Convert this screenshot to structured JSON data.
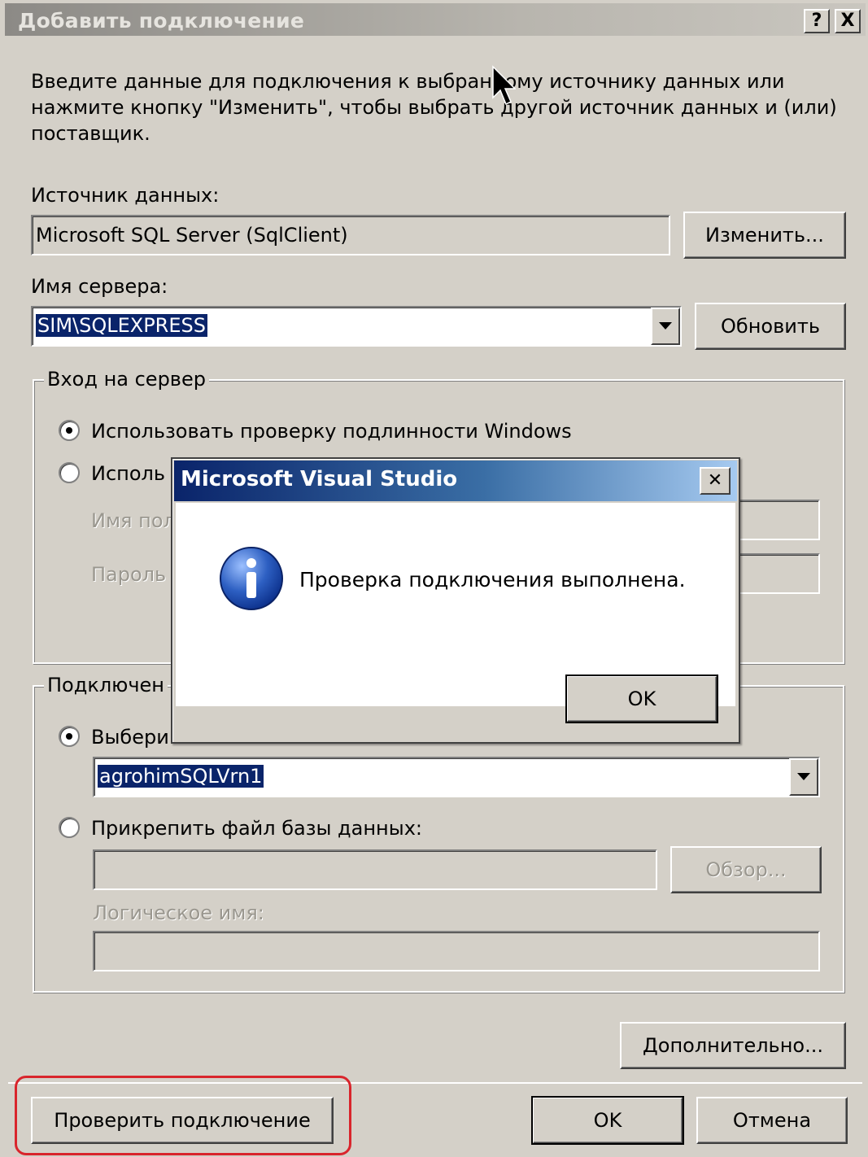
{
  "window": {
    "title": "Добавить подключение",
    "help_btn": "?",
    "close_btn": "X"
  },
  "intro": "Введите данные для подключения к выбранному источнику данных или нажмите кнопку \"Изменить\", чтобы выбрать другой источник данных и (или) поставщик.",
  "intro_lines": [
    "Введите данные для подключения к выбранному источнику данных или",
    "нажмите кнопку \"Изменить\", чтобы выбрать другой источник данных и (или)",
    "поставщик."
  ],
  "datasource": {
    "label": "Источник данных:",
    "value": "Microsoft SQL Server (SqlClient)",
    "change_btn": "Изменить..."
  },
  "server": {
    "label": "Имя сервера:",
    "value": "SIM\\SQLEXPRESS",
    "refresh_btn": "Обновить"
  },
  "login_group": {
    "label": "Вход на сервер",
    "windows_auth": "Использовать проверку подлинности Windows",
    "sql_auth_partial": "Исполь",
    "username_partial": "Имя пол",
    "password_partial": "Пароль"
  },
  "db_group": {
    "label_partial": "Подключен",
    "select_partial": "Выбери",
    "db_value": "agrohimSQLVrn1",
    "attach_label": "Прикрепить файл базы данных:",
    "browse_btn": "Обзор...",
    "logical_name_label": "Логическое имя:"
  },
  "buttons": {
    "advanced": "Дополнительно...",
    "test": "Проверить подключение",
    "ok": "OK",
    "cancel": "Отмена"
  },
  "msgbox": {
    "title": "Microsoft Visual Studio",
    "close_btn": "✕",
    "message": "Проверка подключения выполнена.",
    "ok_btn": "OK",
    "icon_glyph": "i"
  },
  "colors": {
    "selection": "#0a246a",
    "highlight_border": "#d9252c",
    "info_icon": "#2d5fc2"
  }
}
